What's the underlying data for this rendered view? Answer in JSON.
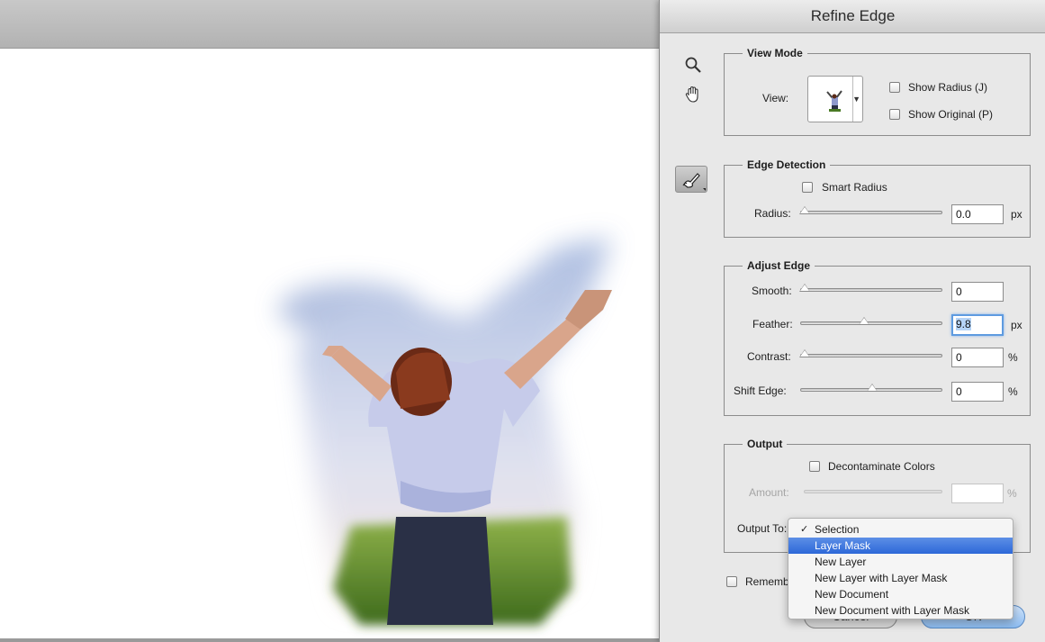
{
  "dialog": {
    "title": "Refine Edge"
  },
  "tools": {
    "zoom": "zoom-icon",
    "hand": "hand-icon",
    "refine_radius": "refine-radius-brush-icon"
  },
  "view_mode": {
    "title": "View Mode",
    "view_label": "View:",
    "show_radius": {
      "label": "Show Radius (J)",
      "checked": false
    },
    "show_original": {
      "label": "Show Original (P)",
      "checked": false
    }
  },
  "edge_detection": {
    "title": "Edge Detection",
    "smart_radius": {
      "label": "Smart Radius",
      "checked": false
    },
    "radius": {
      "label": "Radius:",
      "value": "0.0",
      "unit": "px",
      "slider": 0.0
    }
  },
  "adjust_edge": {
    "title": "Adjust Edge",
    "smooth": {
      "label": "Smooth:",
      "value": "0",
      "unit": "",
      "slider": 0.0
    },
    "feather": {
      "label": "Feather:",
      "value": "9.8",
      "unit": "px",
      "slider": 0.45
    },
    "contrast": {
      "label": "Contrast:",
      "value": "0",
      "unit": "%",
      "slider": 0.0
    },
    "shift_edge": {
      "label": "Shift Edge:",
      "value": "0",
      "unit": "%",
      "slider": 0.5
    }
  },
  "output": {
    "title": "Output",
    "decontaminate": {
      "label": "Decontaminate Colors",
      "checked": false
    },
    "amount": {
      "label": "Amount:",
      "value": "",
      "unit": "%"
    },
    "output_to_label": "Output To:"
  },
  "remember": {
    "label": "Remember Settings",
    "checked": false
  },
  "buttons": {
    "cancel": "Cancel",
    "ok": "OK"
  },
  "dropdown": {
    "items": [
      "Selection",
      "Layer Mask",
      "New Layer",
      "New Layer with Layer Mask",
      "New Document",
      "New Document with Layer Mask"
    ],
    "checked_item": "Selection",
    "highlighted_item": "Layer Mask"
  },
  "colors": {
    "menu_highlight": "#3a74dc",
    "field_focus": "#5e9be0",
    "dialog_bg": "#e8e8e8"
  }
}
